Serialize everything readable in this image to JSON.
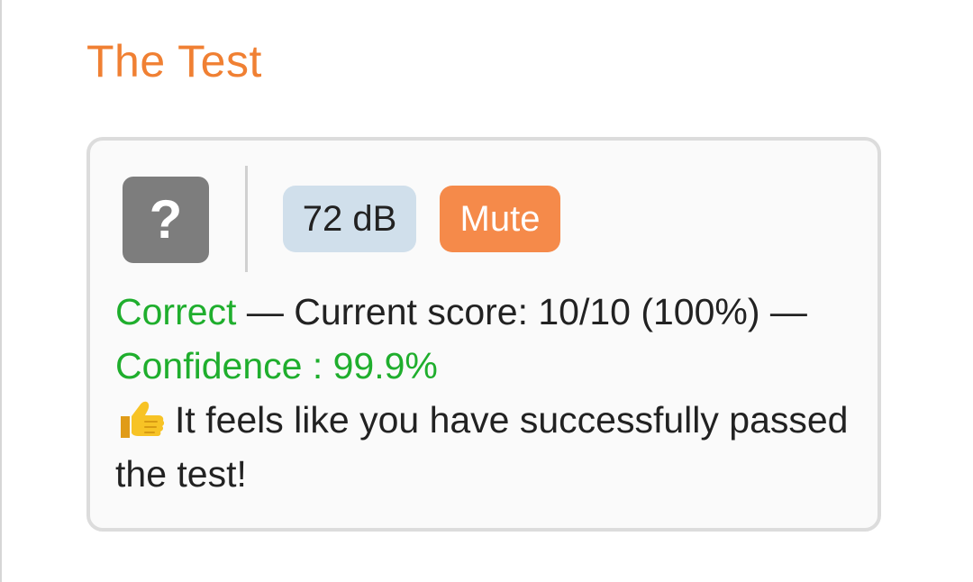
{
  "page": {
    "title": "The Test"
  },
  "card": {
    "help_icon_glyph": "?",
    "sound_level": "72 dB",
    "mute_label": "Mute",
    "result_label": "Correct",
    "separator": " — ",
    "score_text": "Current score: 10/10 (100%)",
    "trailing_separator": " —",
    "confidence_text": "Confidence : 99.9%",
    "message_icon": "thumbs-up-icon",
    "message_text": "It feels like you have successfully passed the test!"
  },
  "colors": {
    "title": "#f08033",
    "mute_button": "#f58a4a",
    "db_badge": "#d0dfeb",
    "help_button": "#7d7d7d",
    "success_text": "#1fae2d"
  }
}
